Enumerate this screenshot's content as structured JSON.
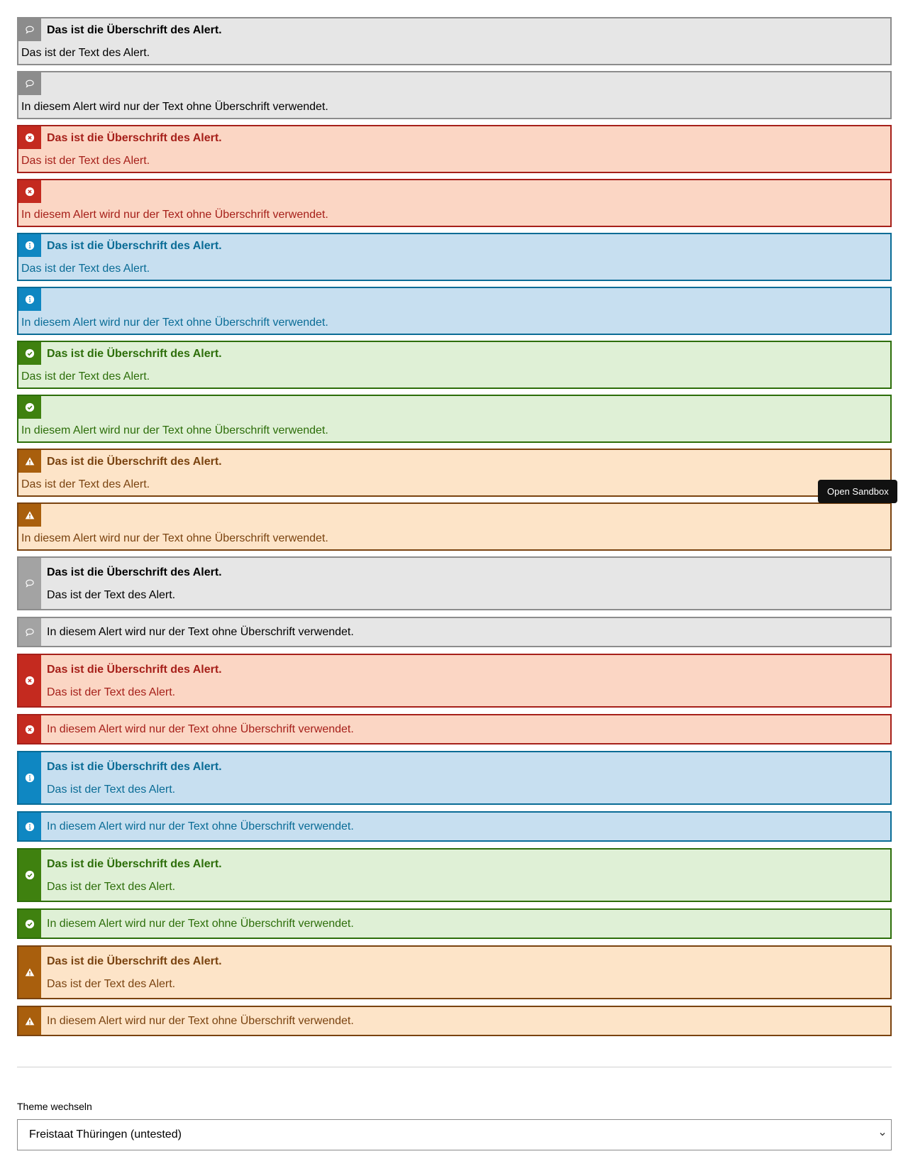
{
  "alerts": [
    {
      "layout": "stack",
      "variant": "default",
      "icon": "speech-bubble-icon",
      "title": "Das ist die Überschrift des Alert.",
      "text": "Das ist der Text des Alert."
    },
    {
      "layout": "stack",
      "variant": "default",
      "icon": "speech-bubble-icon",
      "title": "",
      "text": "In diesem Alert wird nur der Text ohne Überschrift verwendet."
    },
    {
      "layout": "stack",
      "variant": "error",
      "icon": "error-icon",
      "title": "Das ist die Überschrift des Alert.",
      "text": "Das ist der Text des Alert."
    },
    {
      "layout": "stack",
      "variant": "error",
      "icon": "error-icon",
      "title": "",
      "text": "In diesem Alert wird nur der Text ohne Überschrift verwendet."
    },
    {
      "layout": "stack",
      "variant": "info",
      "icon": "info-icon",
      "title": "Das ist die Überschrift des Alert.",
      "text": "Das ist der Text des Alert."
    },
    {
      "layout": "stack",
      "variant": "info",
      "icon": "info-icon",
      "title": "",
      "text": "In diesem Alert wird nur der Text ohne Überschrift verwendet."
    },
    {
      "layout": "stack",
      "variant": "success",
      "icon": "checkmark-icon",
      "title": "Das ist die Überschrift des Alert.",
      "text": "Das ist der Text des Alert."
    },
    {
      "layout": "stack",
      "variant": "success",
      "icon": "checkmark-icon",
      "title": "",
      "text": "In diesem Alert wird nur der Text ohne Überschrift verwendet."
    },
    {
      "layout": "stack",
      "variant": "warning",
      "icon": "warning-icon",
      "title": "Das ist die Überschrift des Alert.",
      "text": "Das ist der Text des Alert."
    },
    {
      "layout": "stack",
      "variant": "warning",
      "icon": "warning-icon",
      "title": "",
      "text": "In diesem Alert wird nur der Text ohne Überschrift verwendet."
    },
    {
      "layout": "side",
      "variant": "default",
      "icon": "speech-bubble-icon",
      "title": "Das ist die Überschrift des Alert.",
      "text": "Das ist der Text des Alert."
    },
    {
      "layout": "side",
      "variant": "default",
      "icon": "speech-bubble-icon",
      "title": "",
      "text": "In diesem Alert wird nur der Text ohne Überschrift verwendet."
    },
    {
      "layout": "side",
      "variant": "error",
      "icon": "error-icon",
      "title": "Das ist die Überschrift des Alert.",
      "text": "Das ist der Text des Alert."
    },
    {
      "layout": "side",
      "variant": "error",
      "icon": "error-icon",
      "title": "",
      "text": "In diesem Alert wird nur der Text ohne Überschrift verwendet."
    },
    {
      "layout": "side",
      "variant": "info",
      "icon": "info-icon",
      "title": "Das ist die Überschrift des Alert.",
      "text": "Das ist der Text des Alert."
    },
    {
      "layout": "side",
      "variant": "info",
      "icon": "info-icon",
      "title": "",
      "text": "In diesem Alert wird nur der Text ohne Überschrift verwendet."
    },
    {
      "layout": "side",
      "variant": "success",
      "icon": "checkmark-icon",
      "title": "Das ist die Überschrift des Alert.",
      "text": "Das ist der Text des Alert."
    },
    {
      "layout": "side",
      "variant": "success",
      "icon": "checkmark-icon",
      "title": "",
      "text": "In diesem Alert wird nur der Text ohne Überschrift verwendet."
    },
    {
      "layout": "side",
      "variant": "warning",
      "icon": "warning-icon",
      "title": "Das ist die Überschrift des Alert.",
      "text": "Das ist der Text des Alert."
    },
    {
      "layout": "side",
      "variant": "warning",
      "icon": "warning-icon",
      "title": "",
      "text": "In diesem Alert wird nur der Text ohne Überschrift verwendet."
    }
  ],
  "colors": {
    "default_bg": "#e6e6e6",
    "default_border": "#8c8c8c",
    "error_bg": "#fbd6c4",
    "error_accent": "#c42a1f",
    "info_bg": "#c7dff0",
    "info_accent": "#0f87c2",
    "success_bg": "#dff0d6",
    "success_accent": "#3f810f",
    "warning_bg": "#fde4c8",
    "warning_accent": "#a95f0d"
  },
  "sandbox_button": {
    "label": "Open Sandbox"
  },
  "theme": {
    "label": "Theme wechseln",
    "selected": "Freistaat Thüringen (untested)",
    "icon": "chevron-down-icon"
  }
}
